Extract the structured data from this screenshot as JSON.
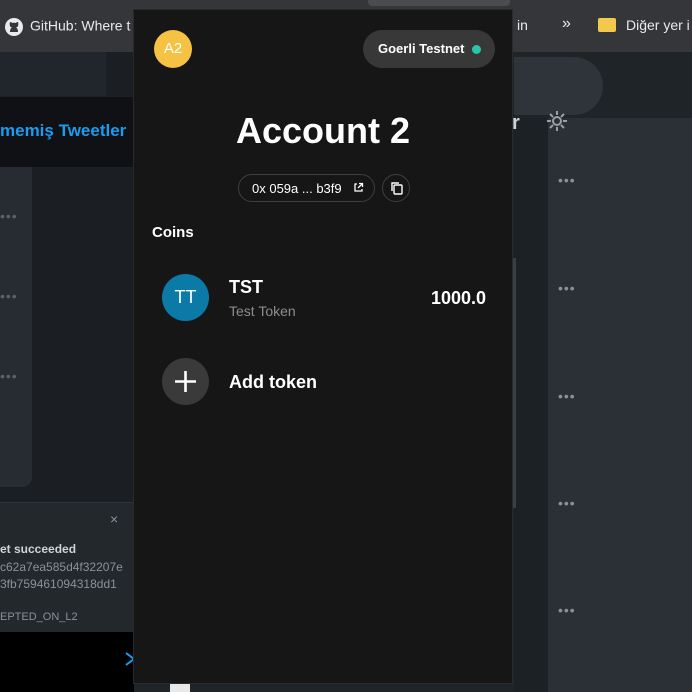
{
  "browser": {
    "bookmarks": [
      {
        "label": "GitHub: Where t",
        "icon": "github-icon"
      },
      {
        "label": "in",
        "icon": ""
      },
      {
        "label": "»",
        "icon": "overflow-chevron-icon"
      },
      {
        "label": "Diğer yer i",
        "icon": "folder-icon"
      }
    ]
  },
  "background_page": {
    "tweet_title": "memiş Tweetler",
    "toast": {
      "close": "×",
      "line1": "et succeeded",
      "line2": "c62a7ea585d4f32207e",
      "line3": "3fb759461094318dd1",
      "line4": "EPTED_ON_L2"
    },
    "more_dots": "•••",
    "partial_letter": "r"
  },
  "wallet": {
    "avatar_initials": "A2",
    "avatar_color": "#f5c243",
    "network": {
      "label": "Goerli Testnet",
      "status_color": "#29c4a9"
    },
    "account_name": "Account 2",
    "address_short": "0x 059a ... b3f9",
    "section_title": "Coins",
    "tokens": [
      {
        "initials": "TT",
        "symbol": "TST",
        "name": "Test Token",
        "balance": "1000.0",
        "color": "#0b7aa7"
      }
    ],
    "add_token_label": "Add token"
  }
}
